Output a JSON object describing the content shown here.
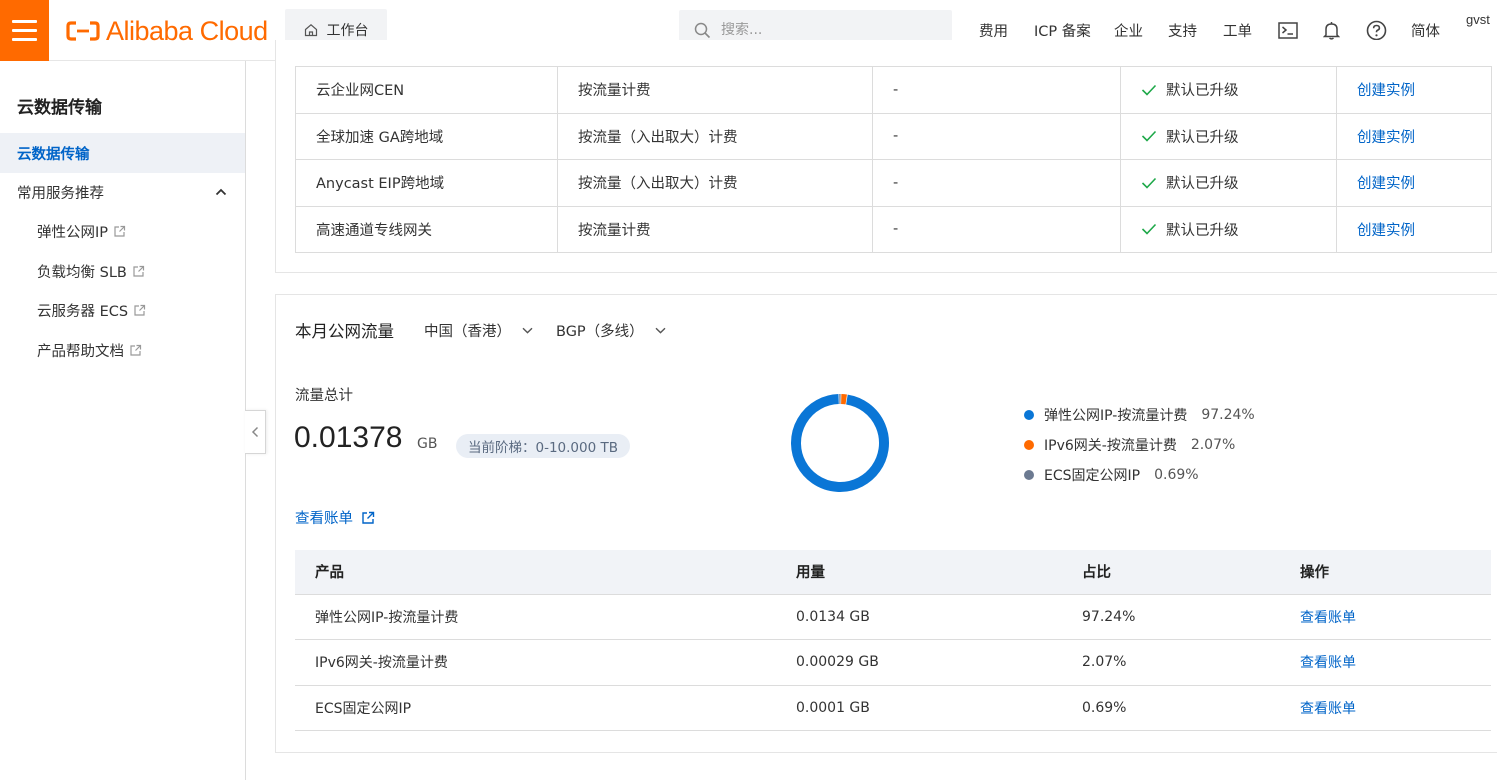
{
  "header": {
    "logo_text": "Alibaba Cloud",
    "workbench_label": "工作台",
    "search_placeholder": "搜索...",
    "nav": [
      "费用",
      "ICP 备案",
      "企业",
      "支持",
      "工单"
    ],
    "lang_label": "简体",
    "user_label": "gvst",
    "brand_color": "#ff6a00",
    "icons": [
      "terminal-icon",
      "bell-icon",
      "help-icon"
    ]
  },
  "sidebar": {
    "title": "云数据传输",
    "active_item": "云数据传输",
    "group_label": "常用服务推荐",
    "links": [
      "弹性公网IP",
      "负载均衡 SLB",
      "云服务器 ECS",
      "产品帮助文档"
    ]
  },
  "feature_table": {
    "rows": [
      {
        "product": "云企业网CEN",
        "billing": "按流量计费",
        "dash": "-",
        "status": "默认已升级",
        "action": "创建实例"
      },
      {
        "product": "全球加速 GA跨地域",
        "billing": "按流量（入出取大）计费",
        "dash": "-",
        "status": "默认已升级",
        "action": "创建实例"
      },
      {
        "product": "Anycast EIP跨地域",
        "billing": "按流量（入出取大）计费",
        "dash": "-",
        "status": "默认已升级",
        "action": "创建实例"
      },
      {
        "product": "高速通道专线网关",
        "billing": "按流量计费",
        "dash": "-",
        "status": "默认已升级",
        "action": "创建实例"
      }
    ]
  },
  "traffic": {
    "title": "本月公网流量",
    "region_select": "中国（香港）",
    "line_select": "BGP（多线）",
    "total_label": "流量总计",
    "total_value": "0.01378",
    "total_unit": "GB",
    "tier_badge": "当前阶梯：0-10.000 TB",
    "view_bill_label": "查看账单"
  },
  "chart_data": {
    "type": "pie",
    "categories": [
      "弹性公网IP-按流量计费",
      "IPv6网关-按流量计费",
      "ECS固定公网IP"
    ],
    "values": [
      97.24,
      2.07,
      0.69
    ],
    "value_labels": [
      "97.24%",
      "2.07%",
      "0.69%"
    ],
    "colors": [
      "#0a76d6",
      "#ff6a00",
      "#6c7a91"
    ],
    "legend": "right"
  },
  "product_table": {
    "headers": [
      "产品",
      "用量",
      "占比",
      "操作"
    ],
    "rows": [
      {
        "product": "弹性公网IP-按流量计费",
        "usage": "0.0134 GB",
        "ratio": "97.24%",
        "action": "查看账单"
      },
      {
        "product": "IPv6网关-按流量计费",
        "usage": "0.00029 GB",
        "ratio": "2.07%",
        "action": "查看账单"
      },
      {
        "product": "ECS固定公网IP",
        "usage": "0.0001 GB",
        "ratio": "0.69%",
        "action": "查看账单"
      }
    ]
  }
}
